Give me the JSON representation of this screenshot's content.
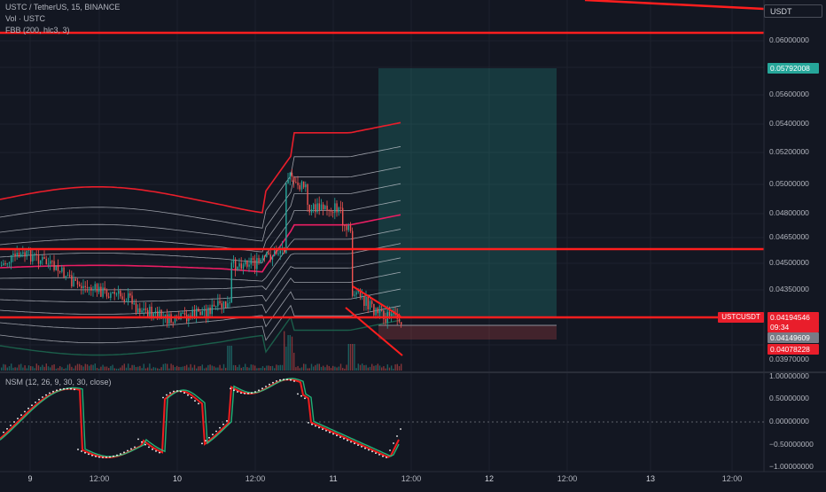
{
  "header": {
    "title": "USTC / TetherUS, 15, BINANCE",
    "volume_label": "Vol · USTC",
    "indicator_label": "FBB (200, hlc3, 3)",
    "symbol_box": "USDT"
  },
  "oscillator": {
    "label": "NSM (12, 26, 9, 30, 30, close)",
    "ticks": [
      "1.00000000",
      "0.50000000",
      "0.00000000",
      "−0.50000000",
      "−1.00000000"
    ]
  },
  "price_axis": {
    "ticks": [
      "0.06000000",
      "0.05600000",
      "0.05400000",
      "0.05200000",
      "0.05000000",
      "0.04800000",
      "0.04650000",
      "0.04500000",
      "0.04350000",
      "0.03970000"
    ]
  },
  "labels": {
    "target_price": "0.05792008",
    "symbol_tag": "USTCUSDT",
    "current_price": "0.04194546",
    "countdown": "09:34",
    "entry_price": "0.04149609",
    "stop_price": "0.04078228"
  },
  "time_axis": {
    "labels": [
      "9",
      "12:00",
      "10",
      "12:00",
      "11",
      "12:00",
      "12",
      "12:00",
      "13",
      "12:00"
    ]
  },
  "colors": {
    "background": "#131722",
    "up": "#26a69a",
    "down": "#ef5350",
    "band_outer": "#e91e2b",
    "band_mid": "#e91e63",
    "level_line": "#ff1e1e",
    "target_zone": "rgba(38,166,154,0.22)",
    "stop_zone": "rgba(239,83,80,0.22)"
  },
  "chart_data": {
    "type": "candlestick",
    "x": [
      "9",
      "12:00",
      "10",
      "12:00",
      "11",
      "12:00",
      "12",
      "12:00",
      "13",
      "12:00"
    ],
    "horizontal_levels": [
      0.0609,
      0.0463,
      0.0419
    ],
    "price_range": [
      0.039,
      0.062
    ],
    "trade_box": {
      "target": 0.05792008,
      "entry": 0.04149609,
      "stop": 0.04078228
    },
    "oscillator_range": [
      -1.0,
      1.0
    ]
  }
}
